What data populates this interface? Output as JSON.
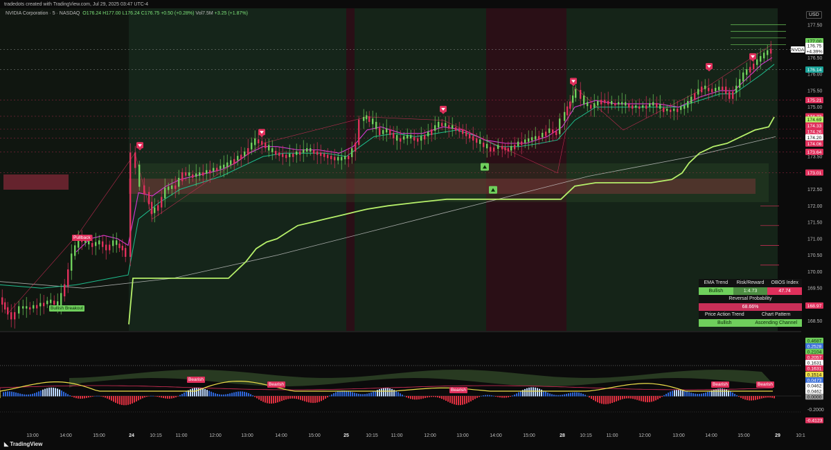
{
  "header": {
    "watermark": "tradedots created with TradingView.com, Jul 29, 2025 03:47 UTC-4",
    "symbol_desc": "NVIDIA Corporation · 5 · NASDAQ",
    "o": "O176.24",
    "h": "H177.00",
    "l": "L176.24",
    "c": "C176.75",
    "chg": "+0.50 (+0.28%)",
    "vol": "Vol7.5M",
    "vol_chg": "+3.25 (+1.87%)",
    "currency": "USD"
  },
  "footer": {
    "brand": "TradingView"
  },
  "price_axis": {
    "ticks": [
      "177.50",
      "177.00",
      "176.50",
      "176.00",
      "175.50",
      "175.00",
      "174.50",
      "174.00",
      "173.50",
      "173.00",
      "172.50",
      "172.00",
      "171.50",
      "171.00",
      "170.50",
      "170.00",
      "169.50",
      "169.00",
      "168.50"
    ],
    "labels": [
      {
        "text": "177.00",
        "price": 177.0,
        "color": "#6fcf5c",
        "fg": "#0b2a08"
      },
      {
        "text": "NVDA",
        "price": 176.75,
        "color": "#ffffff",
        "fg": "#111111"
      },
      {
        "text": "176.75",
        "price": 176.86,
        "color": "#ffffff",
        "fg": "#111111"
      },
      {
        "text": "+4.39%",
        "price": 176.7,
        "color": "#ffffff",
        "fg": "#111111"
      },
      {
        "text": "176.14",
        "price": 176.14,
        "color": "#1aa39a",
        "fg": "#ffffff"
      },
      {
        "text": "175.21",
        "price": 175.21,
        "color": "#e0305c",
        "fg": "#ffffff"
      },
      {
        "text": "174.72",
        "price": 174.72,
        "color": "#e0305c",
        "fg": "#ffffff"
      },
      {
        "text": "174.69",
        "price": 174.62,
        "color": "#b6f06a",
        "fg": "#0b2a08"
      },
      {
        "text": "174.33",
        "price": 174.44,
        "color": "#e0305c",
        "fg": "#ffffff"
      },
      {
        "text": "174.26",
        "price": 174.26,
        "color": "#e0305c",
        "fg": "#ffffff"
      },
      {
        "text": "174.20",
        "price": 174.08,
        "color": "#ffffff",
        "fg": "#111111"
      },
      {
        "text": "174.06",
        "price": 173.89,
        "color": "#e0305c",
        "fg": "#ffffff"
      },
      {
        "text": "173.64",
        "price": 173.64,
        "color": "#e0305c",
        "fg": "#ffffff"
      },
      {
        "text": "173.01",
        "price": 173.01,
        "color": "#e0305c",
        "fg": "#ffffff"
      },
      {
        "text": "168.97",
        "price": 168.97,
        "color": "#e0305c",
        "fg": "#ffffff"
      }
    ]
  },
  "osc_axis": {
    "labels": [
      {
        "text": "0.4687",
        "color": "#6fcf5c",
        "fg": "#0b2a08"
      },
      {
        "text": "0.2528",
        "color": "#3a6fd8",
        "fg": "#ffffff"
      },
      {
        "text": "0.2104",
        "color": "#6fcf5c",
        "fg": "#0b2a08"
      },
      {
        "text": "0.2057",
        "color": "#e0305c",
        "fg": "#ffffff"
      },
      {
        "text": "0.1631",
        "color": "#ffffff",
        "fg": "#111111"
      },
      {
        "text": "0.1631",
        "color": "#e0305c",
        "fg": "#ffffff"
      },
      {
        "text": "0.1514",
        "color": "#f0e04a",
        "fg": "#111111"
      },
      {
        "text": "0.0473",
        "color": "#3a6fd8",
        "fg": "#ffffff"
      },
      {
        "text": "0.0462",
        "color": "#ffffff",
        "fg": "#111111"
      },
      {
        "text": "0.0462",
        "color": "#ffffff",
        "fg": "#111111"
      },
      {
        "text": "0.0000",
        "color": "#9a9a9a",
        "fg": "#111111"
      }
    ],
    "plain": [
      "-0.2000"
    ],
    "bottom": {
      "text": "-0.4123",
      "color": "#e0305c",
      "fg": "#ffffff"
    }
  },
  "time_axis": [
    "13:00",
    "14:00",
    "15:00",
    "24",
    "10:15",
    "11:00",
    "12:00",
    "13:00",
    "14:00",
    "15:00",
    "25",
    "10:15",
    "11:00",
    "12:00",
    "13:00",
    "14:00",
    "15:00",
    "28",
    "10:15",
    "11:00",
    "12:00",
    "13:00",
    "14:00",
    "15:00",
    "29",
    "10:1"
  ],
  "annotations": {
    "bullish_breakout": "Bullish Breakout",
    "pullback": "Pullback",
    "bearish": [
      "Bearish",
      "Bearish",
      "Bearish",
      "Bearish",
      "Bearish"
    ]
  },
  "dashboard": {
    "h1": [
      "EMA Trend",
      "Risk/Reward",
      "OBOS Index"
    ],
    "v1": [
      "Bullish",
      "1:4.73",
      "47.74"
    ],
    "reversal_label": "Reversal Probability",
    "reversal_value": "68.66%",
    "h2": [
      "Price Action Trend",
      "Chart Pattern"
    ],
    "v2": [
      "Bullish",
      "Ascending Channel"
    ]
  },
  "colors": {
    "bull": "#6fcf5c",
    "bear": "#e0305c",
    "bg": "#0b0b0b",
    "lime": "#b6f06a"
  },
  "chart_data": {
    "type": "candlestick",
    "symbol": "NVDA",
    "timeframe": "5",
    "ylim": [
      168.2,
      178.0
    ],
    "x_ticks": [
      "13:00",
      "14:00",
      "15:00",
      "24",
      "10:15",
      "11:00",
      "12:00",
      "13:00",
      "14:00",
      "15:00",
      "25",
      "10:15",
      "11:00",
      "12:00",
      "13:00",
      "14:00",
      "15:00",
      "28",
      "10:15",
      "11:00",
      "12:00",
      "13:00",
      "14:00",
      "15:00",
      "29",
      "10:1"
    ],
    "close_path": [
      [
        0,
        169.2
      ],
      [
        8,
        168.9
      ],
      [
        18,
        168.6
      ],
      [
        30,
        168.9
      ],
      [
        45,
        168.9
      ],
      [
        60,
        169.0
      ],
      [
        75,
        169.1
      ],
      [
        85,
        169.0
      ],
      [
        95,
        169.6
      ],
      [
        105,
        170.5
      ],
      [
        115,
        171.0
      ],
      [
        125,
        170.9
      ],
      [
        135,
        170.8
      ],
      [
        145,
        170.9
      ],
      [
        155,
        170.7
      ],
      [
        165,
        170.9
      ],
      [
        178,
        170.7
      ],
      [
        185,
        170.5
      ],
      [
        192,
        173.6
      ],
      [
        198,
        173.2
      ],
      [
        205,
        172.6
      ],
      [
        212,
        172.4
      ],
      [
        220,
        171.8
      ],
      [
        230,
        172.0
      ],
      [
        240,
        172.5
      ],
      [
        255,
        172.6
      ],
      [
        265,
        173.0
      ],
      [
        280,
        172.9
      ],
      [
        295,
        173.0
      ],
      [
        310,
        173.1
      ],
      [
        325,
        173.2
      ],
      [
        340,
        173.4
      ],
      [
        355,
        173.6
      ],
      [
        370,
        174.0
      ],
      [
        380,
        173.9
      ],
      [
        390,
        173.7
      ],
      [
        400,
        173.6
      ],
      [
        415,
        173.5
      ],
      [
        430,
        173.6
      ],
      [
        445,
        173.7
      ],
      [
        460,
        173.6
      ],
      [
        475,
        173.5
      ],
      [
        490,
        173.4
      ],
      [
        505,
        173.5
      ],
      [
        515,
        173.9
      ],
      [
        522,
        174.6
      ],
      [
        530,
        174.7
      ],
      [
        540,
        174.5
      ],
      [
        550,
        174.2
      ],
      [
        560,
        174.3
      ],
      [
        575,
        174.0
      ],
      [
        590,
        174.1
      ],
      [
        605,
        174.0
      ],
      [
        620,
        174.2
      ],
      [
        635,
        174.5
      ],
      [
        650,
        174.4
      ],
      [
        665,
        174.3
      ],
      [
        680,
        174.1
      ],
      [
        695,
        173.9
      ],
      [
        710,
        173.7
      ],
      [
        722,
        173.8
      ],
      [
        735,
        173.7
      ],
      [
        750,
        173.9
      ],
      [
        765,
        174.0
      ],
      [
        780,
        174.1
      ],
      [
        795,
        174.3
      ],
      [
        805,
        174.2
      ],
      [
        812,
        174.6
      ],
      [
        820,
        175.0
      ],
      [
        828,
        175.3
      ],
      [
        835,
        175.5
      ],
      [
        845,
        175.1
      ],
      [
        855,
        175.0
      ],
      [
        870,
        175.2
      ],
      [
        885,
        175.1
      ],
      [
        900,
        175.1
      ],
      [
        915,
        175.0
      ],
      [
        930,
        175.0
      ],
      [
        945,
        175.1
      ],
      [
        960,
        174.9
      ],
      [
        975,
        174.9
      ],
      [
        990,
        175.0
      ],
      [
        1005,
        175.4
      ],
      [
        1015,
        175.6
      ],
      [
        1030,
        175.5
      ],
      [
        1045,
        175.6
      ],
      [
        1055,
        175.3
      ],
      [
        1065,
        175.6
      ],
      [
        1075,
        176.0
      ],
      [
        1085,
        176.2
      ],
      [
        1095,
        176.4
      ],
      [
        1105,
        176.6
      ],
      [
        1115,
        176.75
      ]
    ],
    "ema_fast_path": [
      [
        110,
        170.6
      ],
      [
        130,
        171.0
      ],
      [
        150,
        171.1
      ],
      [
        170,
        171.0
      ],
      [
        185,
        170.8
      ],
      [
        200,
        172.4
      ],
      [
        220,
        172.3
      ],
      [
        240,
        172.6
      ],
      [
        260,
        172.8
      ],
      [
        280,
        172.9
      ],
      [
        300,
        173.0
      ],
      [
        320,
        173.1
      ],
      [
        340,
        173.3
      ],
      [
        360,
        173.6
      ],
      [
        380,
        173.8
      ],
      [
        400,
        173.8
      ],
      [
        430,
        173.7
      ],
      [
        460,
        173.7
      ],
      [
        490,
        173.6
      ],
      [
        510,
        173.8
      ],
      [
        530,
        174.3
      ],
      [
        550,
        174.4
      ],
      [
        580,
        174.2
      ],
      [
        610,
        174.2
      ],
      [
        640,
        174.4
      ],
      [
        670,
        174.3
      ],
      [
        700,
        174.0
      ],
      [
        730,
        173.9
      ],
      [
        760,
        173.9
      ],
      [
        790,
        174.1
      ],
      [
        812,
        174.4
      ],
      [
        830,
        175.0
      ],
      [
        860,
        175.2
      ],
      [
        890,
        175.1
      ],
      [
        920,
        175.1
      ],
      [
        950,
        175.1
      ],
      [
        980,
        175.0
      ],
      [
        1010,
        175.3
      ],
      [
        1040,
        175.5
      ],
      [
        1060,
        175.5
      ],
      [
        1080,
        175.9
      ],
      [
        1100,
        176.3
      ],
      [
        1115,
        176.5
      ]
    ],
    "ema_slow_path": [
      [
        0,
        169.6
      ],
      [
        60,
        169.5
      ],
      [
        110,
        169.6
      ],
      [
        160,
        169.8
      ],
      [
        185,
        169.9
      ],
      [
        200,
        171.6
      ],
      [
        230,
        172.1
      ],
      [
        260,
        172.5
      ],
      [
        290,
        172.7
      ],
      [
        320,
        172.9
      ],
      [
        350,
        173.2
      ],
      [
        380,
        173.5
      ],
      [
        410,
        173.6
      ],
      [
        440,
        173.6
      ],
      [
        470,
        173.6
      ],
      [
        500,
        173.5
      ],
      [
        520,
        173.8
      ],
      [
        540,
        174.1
      ],
      [
        570,
        174.2
      ],
      [
        600,
        174.1
      ],
      [
        630,
        174.2
      ],
      [
        660,
        174.3
      ],
      [
        690,
        174.1
      ],
      [
        720,
        173.8
      ],
      [
        750,
        173.8
      ],
      [
        780,
        173.9
      ],
      [
        805,
        174.0
      ],
      [
        830,
        174.6
      ],
      [
        860,
        175.0
      ],
      [
        890,
        175.0
      ],
      [
        920,
        175.0
      ],
      [
        950,
        175.0
      ],
      [
        980,
        175.0
      ],
      [
        1010,
        175.2
      ],
      [
        1040,
        175.4
      ],
      [
        1060,
        175.4
      ],
      [
        1080,
        175.7
      ],
      [
        1100,
        176.0
      ],
      [
        1118,
        176.3
      ]
    ],
    "trail_stop_path": [
      [
        186,
        168.4
      ],
      [
        192,
        169.8
      ],
      [
        260,
        169.8
      ],
      [
        330,
        169.8
      ],
      [
        340,
        170.0
      ],
      [
        355,
        170.3
      ],
      [
        370,
        170.7
      ],
      [
        385,
        170.9
      ],
      [
        400,
        171.0
      ],
      [
        415,
        171.2
      ],
      [
        430,
        171.4
      ],
      [
        450,
        171.5
      ],
      [
        470,
        171.6
      ],
      [
        490,
        171.7
      ],
      [
        510,
        171.8
      ],
      [
        530,
        171.9
      ],
      [
        560,
        172.0
      ],
      [
        600,
        172.1
      ],
      [
        645,
        172.2
      ],
      [
        700,
        172.2
      ],
      [
        760,
        172.2
      ],
      [
        810,
        172.2
      ],
      [
        820,
        172.4
      ],
      [
        830,
        172.6
      ],
      [
        860,
        172.7
      ],
      [
        900,
        172.7
      ],
      [
        940,
        172.7
      ],
      [
        970,
        172.8
      ],
      [
        985,
        173.0
      ],
      [
        995,
        173.3
      ],
      [
        1010,
        173.6
      ],
      [
        1030,
        173.8
      ],
      [
        1050,
        173.9
      ],
      [
        1070,
        174.1
      ],
      [
        1090,
        174.3
      ],
      [
        1110,
        174.4
      ],
      [
        1118,
        174.7
      ]
    ],
    "long_trend_path": [
      [
        0,
        169.7
      ],
      [
        120,
        169.5
      ],
      [
        250,
        169.8
      ],
      [
        400,
        170.5
      ],
      [
        550,
        171.3
      ],
      [
        700,
        172.1
      ],
      [
        850,
        172.9
      ],
      [
        1000,
        173.5
      ],
      [
        1120,
        174.1
      ]
    ],
    "markers": [
      {
        "type": "bear",
        "x": 202,
        "price": 173.6
      },
      {
        "type": "bear",
        "x": 378,
        "price": 174.0
      },
      {
        "type": "bear",
        "x": 640,
        "price": 174.7
      },
      {
        "type": "bear",
        "x": 828,
        "price": 175.55
      },
      {
        "type": "bear",
        "x": 1024,
        "price": 176.0
      },
      {
        "type": "bear",
        "x": 1087,
        "price": 176.3
      },
      {
        "type": "bull",
        "x": 700,
        "price": 173.3
      },
      {
        "type": "bull",
        "x": 712,
        "price": 172.6
      }
    ]
  }
}
